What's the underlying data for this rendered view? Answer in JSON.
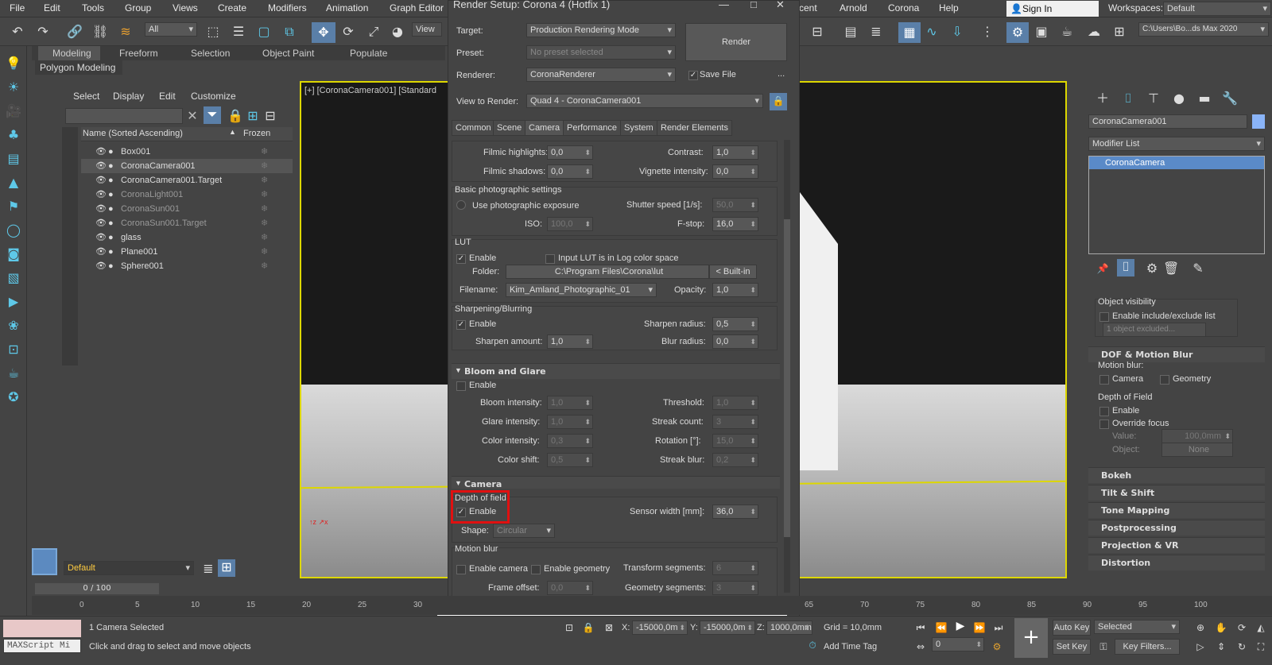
{
  "menubar": {
    "items": [
      "File",
      "Edit",
      "Tools",
      "Group",
      "Views",
      "Create",
      "Modifiers",
      "Animation",
      "Graph Editor"
    ],
    "right_items": [
      "cent",
      "Arnold",
      "Corona",
      "Help"
    ],
    "sign_in": "Sign In",
    "workspaces_label": "Workspaces:",
    "workspaces_value": "Default"
  },
  "toolbar": {
    "selection_filter": "All",
    "view_label": "View",
    "project_path": "C:\\Users\\Bo...ds Max 2020"
  },
  "ribbon": {
    "tabs": [
      "Modeling",
      "Freeform",
      "Selection",
      "Object Paint",
      "Populate"
    ],
    "sub_label": "Polygon Modeling"
  },
  "scene_explorer": {
    "menus": [
      "Select",
      "Display",
      "Edit",
      "Customize"
    ],
    "col_name": "Name (Sorted Ascending)",
    "col_frozen": "Frozen",
    "objects": [
      {
        "name": "Box001",
        "dim": false,
        "selected": false
      },
      {
        "name": "CoronaCamera001",
        "dim": false,
        "selected": true
      },
      {
        "name": "CoronaCamera001.Target",
        "dim": false,
        "selected": false
      },
      {
        "name": "CoronaLight001",
        "dim": true,
        "selected": false
      },
      {
        "name": "CoronaSun001",
        "dim": true,
        "selected": false
      },
      {
        "name": "CoronaSun001.Target",
        "dim": true,
        "selected": false
      },
      {
        "name": "glass",
        "dim": false,
        "selected": false
      },
      {
        "name": "Plane001",
        "dim": false,
        "selected": false
      },
      {
        "name": "Sphere001",
        "dim": false,
        "selected": false
      }
    ],
    "layer": "Default"
  },
  "viewport": {
    "label": "[+] [CoronaCamera001] [Standard"
  },
  "dialog": {
    "title": "Render Setup: Corona 4 (Hotfix 1)",
    "target_label": "Target:",
    "target_value": "Production Rendering Mode",
    "preset_label": "Preset:",
    "preset_value": "No preset selected",
    "renderer_label": "Renderer:",
    "renderer_value": "CoronaRenderer",
    "save_file": "Save File",
    "view_label": "View to Render:",
    "view_value": "Quad 4 - CoronaCamera001",
    "render_btn": "Render",
    "more": "...",
    "tabs": [
      "Common",
      "Scene",
      "Camera",
      "Performance",
      "System",
      "Render Elements"
    ],
    "filmic": {
      "highlights_label": "Filmic highlights:",
      "highlights": "0,0",
      "shadows_label": "Filmic shadows:",
      "shadows": "0,0",
      "contrast_label": "Contrast:",
      "contrast": "1,0",
      "vignette_label": "Vignette intensity:",
      "vignette": "0,0"
    },
    "photo": {
      "title": "Basic photographic settings",
      "use_exposure": "Use photographic exposure",
      "shutter_label": "Shutter speed [1/s]:",
      "shutter": "50,0",
      "iso_label": "ISO:",
      "iso": "100,0",
      "fstop_label": "F-stop:",
      "fstop": "16,0"
    },
    "lut": {
      "title": "LUT",
      "enable": "Enable",
      "log": "Input LUT is in Log color space",
      "folder_label": "Folder:",
      "folder": "C:\\Program Files\\Corona\\lut",
      "builtin": "< Built-in",
      "filename_label": "Filename:",
      "filename": "Kim_Amland_Photographic_01",
      "opacity_label": "Opacity:",
      "opacity": "1,0"
    },
    "sharpen": {
      "title": "Sharpening/Blurring",
      "enable": "Enable",
      "radius_label": "Sharpen radius:",
      "radius": "0,5",
      "amount_label": "Sharpen amount:",
      "amount": "1,0",
      "blur_label": "Blur radius:",
      "blur": "0,0"
    },
    "bloom": {
      "title": "Bloom and Glare",
      "enable": "Enable",
      "bloom_label": "Bloom intensity:",
      "bloom": "1,0",
      "threshold_label": "Threshold:",
      "threshold": "1,0",
      "glare_label": "Glare intensity:",
      "glare": "1,0",
      "streak_count_label": "Streak count:",
      "streak_count": "3",
      "color_label": "Color intensity:",
      "color": "0,3",
      "rotation_label": "Rotation [°]:",
      "rotation": "15,0",
      "shift_label": "Color shift:",
      "shift": "0,5",
      "streak_blur_label": "Streak blur:",
      "streak_blur": "0,2"
    },
    "camera": {
      "title": "Camera",
      "dof_title": "Depth of field",
      "dof_enable": "Enable",
      "sensor_label": "Sensor width [mm]:",
      "sensor": "36,0",
      "shape_label": "Shape:",
      "shape": "Circular",
      "mb_title": "Motion blur",
      "mb_camera": "Enable camera",
      "mb_geometry": "Enable geometry",
      "transform_label": "Transform segments:",
      "transform": "6",
      "offset_label": "Frame offset:",
      "offset": "0,0",
      "geom_seg_label": "Geometry segments:",
      "geom_seg": "3"
    }
  },
  "command_panel": {
    "object_name": "CoronaCamera001",
    "modifier_list": "Modifier List",
    "stack_item": "CoronaCamera",
    "obj_vis": "Object visibility",
    "incl_excl": "Enable include/exclude list",
    "excluded": "1 object excluded...",
    "dof_mb": "DOF & Motion Blur",
    "mb_label": "Motion blur:",
    "mb_cam": "Camera",
    "mb_geo": "Geometry",
    "dof_label": "Depth of Field",
    "dof_enable": "Enable",
    "override": "Override focus",
    "value_label": "Value:",
    "value": "100,0mm",
    "object_label": "Object:",
    "object": "None",
    "rollouts": [
      "Bokeh",
      "Tilt & Shift",
      "Tone Mapping",
      "Postprocessing",
      "Projection & VR",
      "Distortion"
    ]
  },
  "timeline": {
    "frame": "0 / 100",
    "ticks": [
      "0",
      "5",
      "10",
      "15",
      "20",
      "25",
      "30",
      "65",
      "70",
      "75",
      "80",
      "85",
      "90",
      "95",
      "100"
    ]
  },
  "status": {
    "script": "MAXScript Mi",
    "selected": "1 Camera Selected",
    "hint": "Click and drag to select and move objects",
    "x_label": "X:",
    "x": "-15000,0m",
    "y_label": "Y:",
    "y": "-15000,0m",
    "z_label": "Z:",
    "z": "1000,0mm",
    "grid": "Grid = 10,0mm",
    "add_time": "Add Time Tag",
    "auto_key": "Auto Key",
    "selected_dd": "Selected",
    "set_key": "Set Key",
    "key_filters": "Key Filters...",
    "frame_field": "0"
  }
}
